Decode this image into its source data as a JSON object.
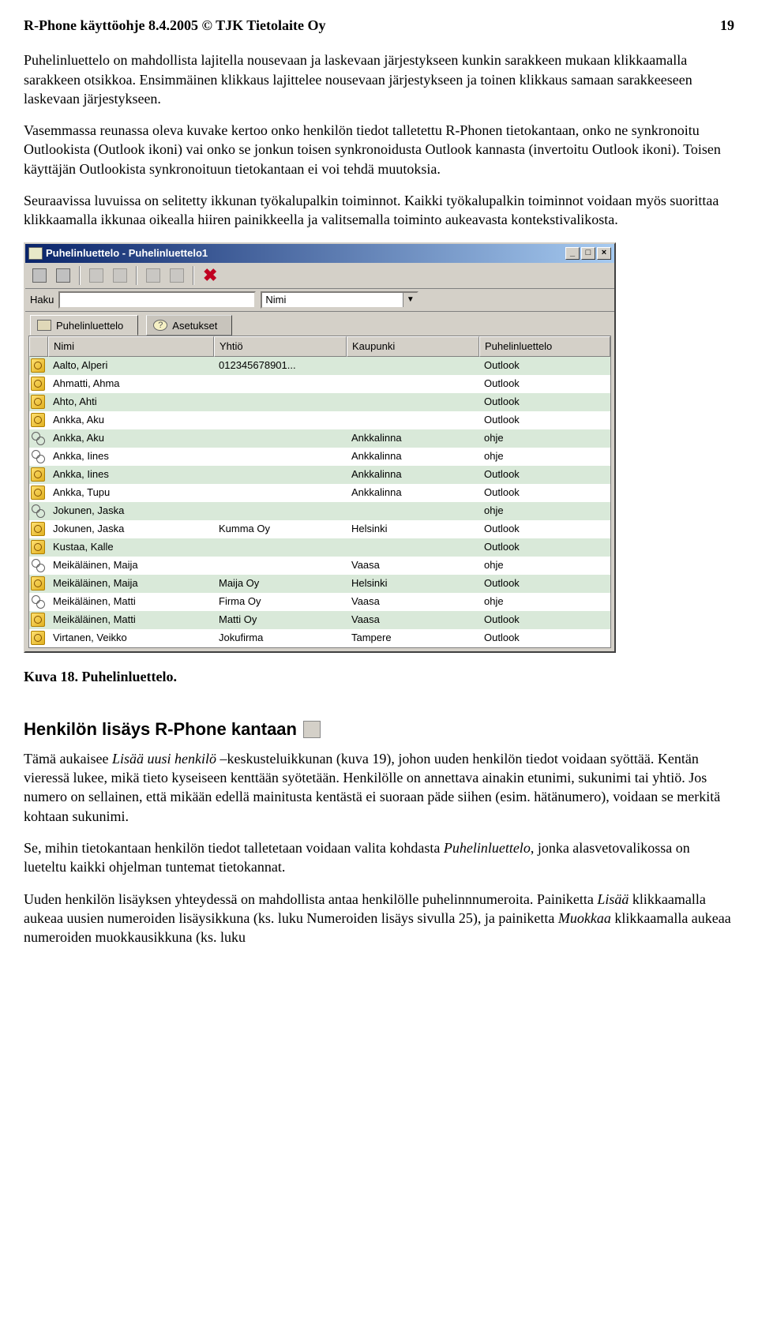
{
  "header": {
    "left": "R-Phone käyttöohje 8.4.2005 © TJK Tietolaite Oy",
    "right": "19"
  },
  "paragraphs": {
    "p1": "Puhelinluettelo on mahdollista lajitella nousevaan ja laskevaan järjestykseen kunkin sarakkeen mukaan klikkaamalla sarakkeen otsikkoa. Ensimmäinen klikkaus lajittelee nousevaan järjestykseen ja toinen klikkaus samaan sarakkeeseen laskevaan järjestykseen.",
    "p2": "Vasemmassa reunassa oleva kuvake kertoo onko henkilön tiedot talletettu R-Phonen tietokantaan, onko ne synkronoitu Outlookista (Outlook ikoni) vai onko se jonkun toisen synkronoidusta Outlook kannasta (invertoitu Outlook ikoni). Toisen käyttäjän Outlookista synkronoituun tietokantaan ei voi tehdä muutoksia.",
    "p3": "Seuraavissa luvuissa on selitetty ikkunan työkalupalkin toiminnot. Kaikki työkalupalkin toiminnot voidaan myös suorittaa klikkaamalla ikkunaa oikealla hiiren painikkeella ja valitsemalla toiminto aukeavasta kontekstivalikosta."
  },
  "caption": "Kuva 18. Puhelinluettelo.",
  "section_heading": "Henkilön lisäys R-Phone kantaan",
  "paragraphs2": {
    "p4a": "Tämä aukaisee ",
    "p4i": "Lisää uusi henkilö",
    "p4b": " –keskusteluikkunan (kuva 19), johon uuden henkilön tiedot voidaan syöttää. Kentän vieressä lukee, mikä tieto kyseiseen kenttään syötetään. Henkilölle on annettava ainakin etunimi, sukunimi tai yhtiö. Jos numero on sellainen, että mikään edellä mainitusta kentästä ei suoraan päde siihen (esim. hätänumero), voidaan se merkitä kohtaan sukunimi.",
    "p5a": "Se, mihin tietokantaan henkilön tiedot talletetaan voidaan valita kohdasta ",
    "p5i": "Puhelinluettelo",
    "p5b": ", jonka alasvetovalikossa on lueteltu kaikki ohjelman tuntemat tietokannat.",
    "p6a": "Uuden henkilön lisäyksen yhteydessä on mahdollista antaa henkilölle puhelinnnumeroita. Painiketta ",
    "p6i1": "Lisää",
    "p6b": " klikkaamalla aukeaa uusien numeroiden lisäysikkuna (ks. luku Numeroiden lisäys sivulla 25), ja painiketta ",
    "p6i2": "Muokkaa",
    "p6c": " klikkaamalla aukeaa numeroiden muokkausikkuna (ks. luku"
  },
  "app": {
    "title": "Puhelinluettelo - Puhelinluettelo1",
    "search_label": "Haku",
    "combo_value": "Nimi",
    "tabs": {
      "phonebook": "Puhelinluettelo",
      "settings": "Asetukset"
    },
    "columns": {
      "c0": "",
      "c1": "Nimi",
      "c2": "Yhtiö",
      "c3": "Kaupunki",
      "c4": "Puhelinluettelo"
    },
    "rows": [
      {
        "icon": "outlook",
        "name": "Aalto, Alperi",
        "company": "012345678901...",
        "city": "",
        "book": "Outlook"
      },
      {
        "icon": "outlook",
        "name": "Ahmatti, Ahma",
        "company": "",
        "city": "",
        "book": "Outlook"
      },
      {
        "icon": "outlook",
        "name": "Ahto, Ahti",
        "company": "",
        "city": "",
        "book": "Outlook"
      },
      {
        "icon": "outlook",
        "name": "Ankka, Aku",
        "company": "",
        "city": "",
        "book": "Outlook"
      },
      {
        "icon": "sync",
        "name": "Ankka, Aku",
        "company": "",
        "city": "Ankkalinna",
        "book": "ohje"
      },
      {
        "icon": "sync",
        "name": "Ankka, Iines",
        "company": "",
        "city": "Ankkalinna",
        "book": "ohje"
      },
      {
        "icon": "outlook",
        "name": "Ankka, Iines",
        "company": "",
        "city": "Ankkalinna",
        "book": "Outlook"
      },
      {
        "icon": "outlook",
        "name": "Ankka, Tupu",
        "company": "",
        "city": "Ankkalinna",
        "book": "Outlook"
      },
      {
        "icon": "sync",
        "name": "Jokunen, Jaska",
        "company": "",
        "city": "",
        "book": "ohje"
      },
      {
        "icon": "outlook",
        "name": "Jokunen, Jaska",
        "company": "Kumma Oy",
        "city": "Helsinki",
        "book": "Outlook"
      },
      {
        "icon": "outlook",
        "name": "Kustaa, Kalle",
        "company": "",
        "city": "",
        "book": "Outlook"
      },
      {
        "icon": "sync",
        "name": "Meikäläinen, Maija",
        "company": "",
        "city": "Vaasa",
        "book": "ohje"
      },
      {
        "icon": "outlook",
        "name": "Meikäläinen, Maija",
        "company": "Maija Oy",
        "city": "Helsinki",
        "book": "Outlook"
      },
      {
        "icon": "sync",
        "name": "Meikäläinen, Matti",
        "company": "Firma Oy",
        "city": "Vaasa",
        "book": "ohje"
      },
      {
        "icon": "outlook",
        "name": "Meikäläinen, Matti",
        "company": "Matti Oy",
        "city": "Vaasa",
        "book": "Outlook"
      },
      {
        "icon": "outlook",
        "name": "Virtanen, Veikko",
        "company": "Jokufirma",
        "city": "Tampere",
        "book": "Outlook"
      }
    ]
  }
}
